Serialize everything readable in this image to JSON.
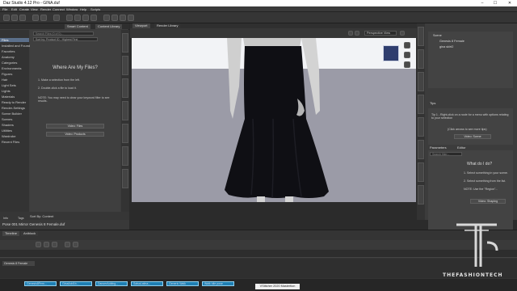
{
  "window": {
    "title": "Daz Studio 4.12 Pro - GINA.duf",
    "minimize": "–",
    "maximize": "☐",
    "close": "✕"
  },
  "menu": [
    "File",
    "Edit",
    "Create",
    "View",
    "Render",
    "Connect",
    "Window",
    "Help",
    "Scripts"
  ],
  "left_panel": {
    "tabs": [
      "Smart Content",
      "Content Library"
    ],
    "categories": [
      "Files",
      "Installed and Found",
      "Favorites",
      "Anatomy",
      "Categories",
      "Environments",
      "Figures",
      "Hair",
      "Light Sets",
      "Lights",
      "Materials",
      "Ready to Render",
      "Render-Settings",
      "Scene Builder",
      "Scenes",
      "Shaders",
      "Utilities",
      "Wardrobe",
      "Recent Files"
    ],
    "search_placeholder": "Search Files (0 of 0)...",
    "sort": "Sort by: Product ID - Highest First",
    "info_heading": "Where Are My Files?",
    "step1": "1. Make a selection from the left.",
    "step2": "2. Double-click a file to load it.",
    "note": "NOTE: You may need to clear your keyword filter to see results.",
    "btn_video_files": "Video: Files",
    "btn_video_products": "Video: Products",
    "footer_sort": "Sort By: Content",
    "poses_title": "Pose 001 Mirror Genesis 8 Female.duf",
    "lower_tabs": [
      "Info",
      "Tags"
    ]
  },
  "viewport": {
    "tabs": [
      "Viewport",
      "Render Library"
    ],
    "camera": "Perspective View"
  },
  "right_panel": {
    "scene_items": [
      "Scene",
      "Genesis 8 Female",
      "gina skirt2"
    ],
    "tips_heading": "Tips",
    "tip1": "Tip 1 - Right-click on a node for a menu with options relating to your selection",
    "tip_next": "(Click arrows to see more tips)",
    "btn_video_scene": "Video: Scene",
    "param_tabs": [
      "Parameters",
      "Editor"
    ],
    "param_search": "Search filter...",
    "what_heading": "What do I do?",
    "p_step1": "1. Select something in your scene.",
    "p_step2": "2. Select something from the list.",
    "p_note": "NOTE: Use the \"Region\"...",
    "btn_video_shaping": "Video: Shaping",
    "show_sub": "Show Sub Items"
  },
  "timeline": {
    "tabs": [
      "Timeline",
      "Aniblock"
    ],
    "track_label": "Genesis 8 Female",
    "clips": [
      "Genesis8Fem...",
      "GinaAdd1b...",
      "DancerAdding...",
      "SalsaLatina...",
      "Generic Walk",
      "Walk Idle pose"
    ]
  },
  "watermark": {
    "brand": "THEFASHIONTECH",
    "caption": "VStitcher 2020 Mastertion"
  },
  "colors": {
    "accent_blue": "#1f7fb3",
    "selection": "#5b6f8a",
    "viewport_bg": "#9a9aa6"
  }
}
